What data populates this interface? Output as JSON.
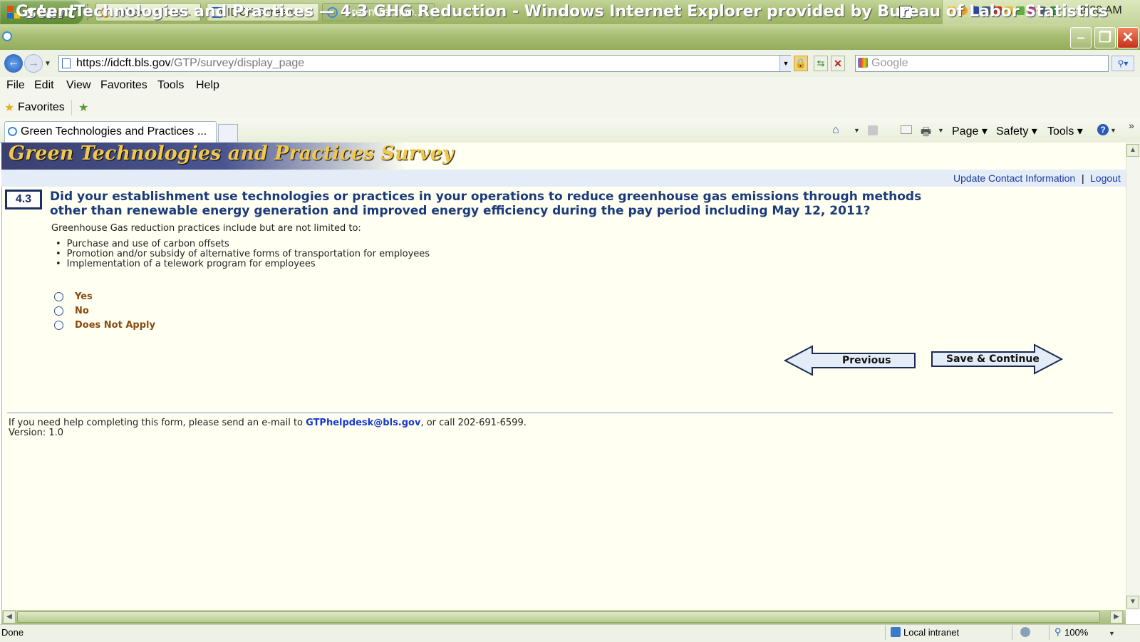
{
  "taskbar": {
    "start_label": "start",
    "windows": [
      {
        "label": "Inbox - Micro..."
      },
      {
        "label": "IDCF Screens..."
      },
      {
        "label": "Green Techno..."
      }
    ],
    "clock": "8:20 AM"
  },
  "window": {
    "title": "Green Technologies and Practices — 4.3 GHG Reduction - Windows Internet Explorer provided by Bureau of Labor Statistics"
  },
  "address": {
    "url_host": "https://idcft.bls.gov",
    "url_path": "/GTP/survey/display_page",
    "search_placeholder": "Google"
  },
  "menu": {
    "items": [
      "File",
      "Edit",
      "View",
      "Favorites",
      "Tools",
      "Help"
    ]
  },
  "favorites": {
    "label": "Favorites"
  },
  "tabs": {
    "active_label": "Green Technologies and Practices ...",
    "commands": [
      "Page",
      "Safety",
      "Tools"
    ]
  },
  "page": {
    "banner_title": "Green Technologies and Practices Survey",
    "links": {
      "update": "Update Contact Information",
      "separator": "|",
      "logout": "Logout"
    },
    "question": {
      "number": "4.3",
      "text": "Did your establishment use technologies or practices in your operations to reduce greenhouse gas emissions through methods other than renewable energy generation and improved energy efficiency during the pay period including May 12, 2011?",
      "intro": "Greenhouse Gas reduction practices include but are not limited to:",
      "bullets": [
        "Purchase and use of carbon offsets",
        "Promotion and/or subsidy of alternative forms of transportation for employees",
        "Implementation of a telework program for employees"
      ],
      "options": [
        "Yes",
        "No",
        "Does Not Apply"
      ],
      "selected": null
    },
    "buttons": {
      "previous": "Previous",
      "save_continue": "Save & Continue"
    },
    "footer": {
      "help_prefix": "If you need help completing this form, please send an e-mail to ",
      "help_email": "GTPhelpdesk@bls.gov",
      "help_suffix": ", or call 202-691-6599.",
      "version": "Version: 1.0"
    }
  },
  "status": {
    "left": "Done",
    "zone": "Local intranet",
    "zoom": "100%"
  },
  "colors": {
    "question_text": "#1a3a7a",
    "option_label": "#8a4a10",
    "banner_title": "#f3c84a",
    "link": "#1a3a9a"
  }
}
